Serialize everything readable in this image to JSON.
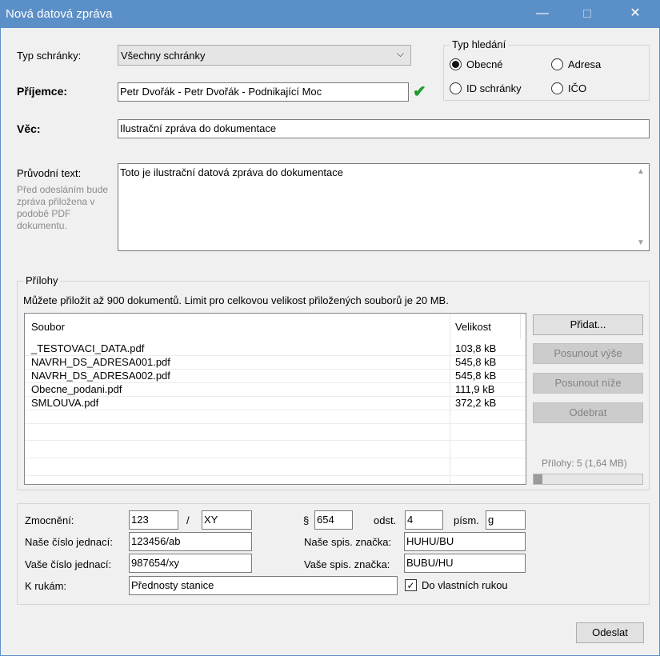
{
  "window": {
    "title": "Nová datová zpráva",
    "minimize_glyph": "—",
    "close_glyph": "✕"
  },
  "form": {
    "typ_schranky_label": "Typ schránky:",
    "typ_schranky_value": "Všechny schránky",
    "prijemce_label": "Příjemce:",
    "prijemce_value": "Petr Dvořák - Petr Dvořák - Podnikající Moc",
    "vec_label": "Věc:",
    "vec_value": "Ilustrační zpráva do dokumentace",
    "pruvodni_label": "Průvodní text:",
    "pruvodni_hint": "Před odesláním bude zpráva přiložena v podobě PDF dokumentu.",
    "pruvodni_value": "Toto je ilustrační datová zpráva do dokumentace"
  },
  "typ_hledani": {
    "legend": "Typ hledání",
    "options": [
      "Obecné",
      "Adresa",
      "ID schránky",
      "IČO"
    ],
    "selected": "Obecné"
  },
  "prilohy": {
    "legend": "Přílohy",
    "info": "Můžete přiložit až 900 dokumentů. Limit pro celkovou velikost přiložených souborů je 20 MB.",
    "columns": [
      "Soubor",
      "Velikost"
    ],
    "rows": [
      [
        "_TESTOVACI_DATA.pdf",
        "103,8 kB"
      ],
      [
        "NAVRH_DS_ADRESA001.pdf",
        "545,8 kB"
      ],
      [
        "NAVRH_DS_ADRESA002.pdf",
        "545,8 kB"
      ],
      [
        "Obecne_podani.pdf",
        "111,9 kB"
      ],
      [
        "SMLOUVA.pdf",
        "372,2 kB"
      ]
    ],
    "buttons": {
      "pridat": "Přidat...",
      "posunout_vyse": "Posunout výše",
      "posunout_nize": "Posunout níže",
      "odebrat": "Odebrat"
    },
    "summary": "Přílohy: 5 (1,64 MB)",
    "usage_fraction": 0.082
  },
  "details": {
    "zmocneni_label": "Zmocnění:",
    "zmocneni_a": "123",
    "zmocneni_slash": "/",
    "zmocneni_b": "XY",
    "paragraf_label": "§",
    "paragraf_value": "654",
    "odst_label": "odst.",
    "odst_value": "4",
    "pism_label": "písm.",
    "pism_value": "g",
    "nase_cj_label": "Naše číslo jednací:",
    "nase_cj_value": "123456/ab",
    "nase_sz_label": "Naše spis. značka:",
    "nase_sz_value": "HUHU/BU",
    "vase_cj_label": "Vaše číslo jednací:",
    "vase_cj_value": "987654/xy",
    "vase_sz_label": "Vaše spis. značka:",
    "vase_sz_value": "BUBU/HU",
    "k_rukam_label": "K rukám:",
    "k_rukam_value": "Přednosty stanice",
    "do_vlastnich_label": "Do vlastních rukou",
    "do_vlastnich_checked": true
  },
  "footer": {
    "odeslat": "Odeslat"
  },
  "colors": {
    "titlebar": "#5b8fc7",
    "check_ok": "#1e9b2e"
  }
}
